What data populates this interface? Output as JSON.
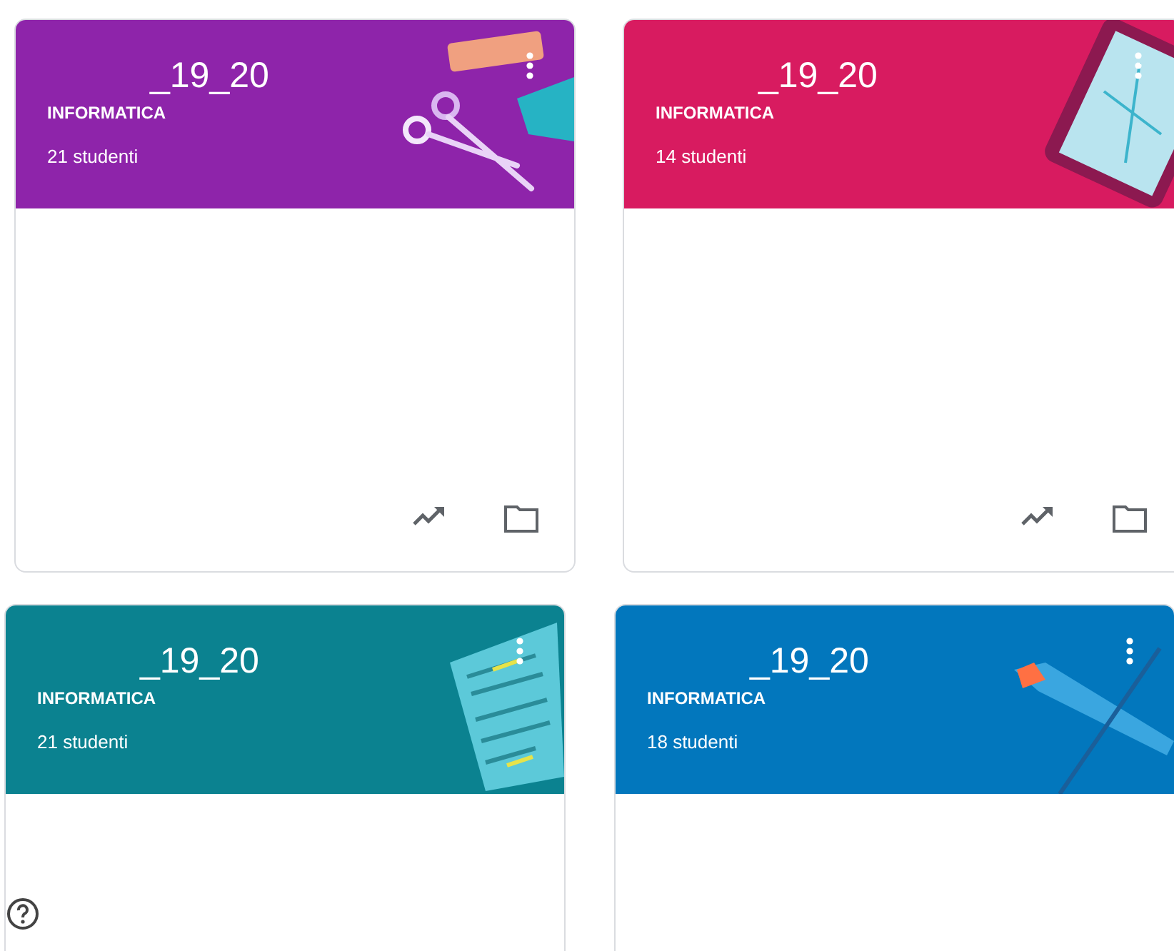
{
  "rows": [
    {
      "cards": [
        {
          "title": "_19_20",
          "section": "INFORMATICA",
          "students": "21 studenti",
          "color": "#8e24aa",
          "kind": "scissors"
        },
        {
          "title": "_19_20",
          "section": "INFORMATICA",
          "students": "14 studenti",
          "color": "#d81b60",
          "kind": "tablet"
        }
      ]
    },
    {
      "cards": [
        {
          "title": "_19_20",
          "section": "INFORMATICA",
          "students": "21 studenti",
          "color": "#0b8290",
          "kind": "paper"
        },
        {
          "title": "_19_20",
          "section": "INFORMATICA",
          "students": "18 studenti",
          "color": "#0277bd",
          "kind": "tools"
        }
      ]
    }
  ]
}
